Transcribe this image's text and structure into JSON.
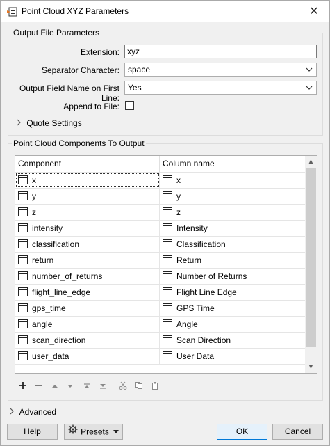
{
  "window": {
    "title": "Point Cloud XYZ Parameters",
    "close_glyph": "✕"
  },
  "output_file": {
    "legend": "Output File Parameters",
    "extension_label": "Extension:",
    "extension_value": "xyz",
    "separator_label": "Separator Character:",
    "separator_value": "space",
    "field_name_label": "Output Field Name on First Line:",
    "field_name_value": "Yes",
    "append_label": "Append to File:",
    "append_checked": false,
    "quote_settings_label": "Quote Settings"
  },
  "components": {
    "legend": "Point Cloud Components To Output",
    "columns": [
      "Component",
      "Column name"
    ],
    "rows": [
      {
        "component": "x",
        "column": "x"
      },
      {
        "component": "y",
        "column": "y"
      },
      {
        "component": "z",
        "column": "z"
      },
      {
        "component": "intensity",
        "column": "Intensity"
      },
      {
        "component": "classification",
        "column": "Classification"
      },
      {
        "component": "return",
        "column": "Return"
      },
      {
        "component": "number_of_returns",
        "column": "Number of Returns"
      },
      {
        "component": "flight_line_edge",
        "column": "Flight Line Edge"
      },
      {
        "component": "gps_time",
        "column": "GPS Time"
      },
      {
        "component": "angle",
        "column": "Angle"
      },
      {
        "component": "scan_direction",
        "column": "Scan Direction"
      },
      {
        "component": "user_data",
        "column": "User Data"
      }
    ],
    "toolbar_icons": [
      "plus-icon",
      "minus-icon",
      "move-up-icon",
      "move-down-icon",
      "move-top-icon",
      "move-bottom-icon",
      "cut-icon",
      "copy-icon",
      "paste-icon"
    ]
  },
  "advanced_label": "Advanced",
  "buttons": {
    "help": "Help",
    "presets": "Presets",
    "ok": "OK",
    "cancel": "Cancel"
  },
  "colors": {
    "default_button_border": "#0078d7",
    "app_icon_orange": "#e87722"
  }
}
